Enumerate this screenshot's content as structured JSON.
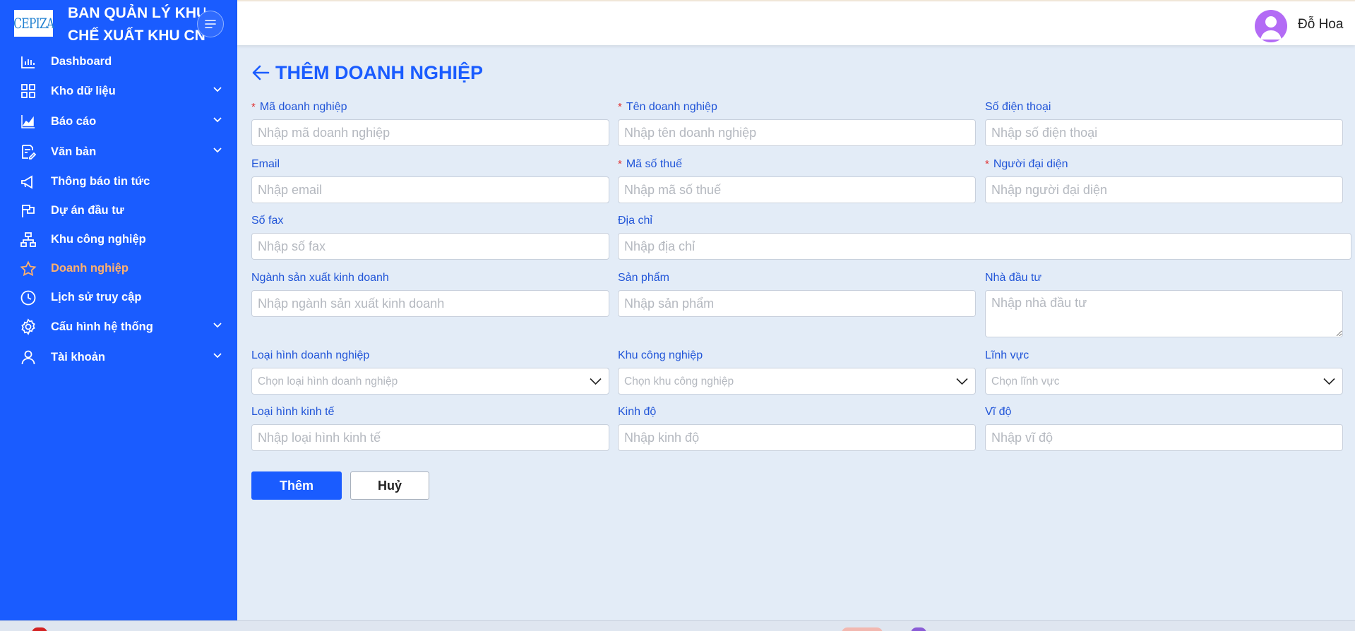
{
  "sidebar": {
    "logo_text": "CEPIZA",
    "brand_line1": "BAN QUẢN LÝ KHU",
    "brand_line2": "CHẾ XUẤT KHU CN",
    "items": [
      {
        "label": "Dashboard",
        "icon": "bar-chart-icon",
        "has_submenu": false
      },
      {
        "label": "Kho dữ liệu",
        "icon": "grid-icon",
        "has_submenu": true
      },
      {
        "label": "Báo cáo",
        "icon": "area-chart-icon",
        "has_submenu": true
      },
      {
        "label": "Văn bản",
        "icon": "document-edit-icon",
        "has_submenu": true
      },
      {
        "label": "Thông báo tin tức",
        "icon": "megaphone-icon",
        "has_submenu": false
      },
      {
        "label": "Dự án đầu tư",
        "icon": "flag-icon",
        "has_submenu": false
      },
      {
        "label": "Khu công nghiệp",
        "icon": "hierarchy-icon",
        "has_submenu": false
      },
      {
        "label": "Doanh nghiệp",
        "icon": "star-icon",
        "has_submenu": false,
        "active": true
      },
      {
        "label": "Lịch sử truy cập",
        "icon": "clock-icon",
        "has_submenu": false
      },
      {
        "label": "Cấu hình hệ thống",
        "icon": "gear-icon",
        "has_submenu": true
      },
      {
        "label": "Tài khoản",
        "icon": "user-icon",
        "has_submenu": true
      }
    ]
  },
  "header": {
    "username": "Đỗ Hoa"
  },
  "page": {
    "title": "THÊM DOANH NGHIỆP"
  },
  "form": {
    "ma_dn": {
      "label": "Mã doanh nghiệp",
      "placeholder": "Nhập mã doanh nghiệp",
      "required": true
    },
    "ten_dn": {
      "label": "Tên doanh nghiệp",
      "placeholder": "Nhập tên doanh nghiệp",
      "required": true
    },
    "sdt": {
      "label": "Số điện thoại",
      "placeholder": "Nhập số điện thoại"
    },
    "email": {
      "label": "Email",
      "placeholder": "Nhập email"
    },
    "mst": {
      "label": "Mã số thuế",
      "placeholder": "Nhập mã số thuế",
      "required": true
    },
    "nguoi_dd": {
      "label": "Người đại diện",
      "placeholder": "Nhập người đại diện",
      "required": true
    },
    "fax": {
      "label": "Số fax",
      "placeholder": "Nhập số fax"
    },
    "dia_chi": {
      "label": "Địa chỉ",
      "placeholder": "Nhập địa chỉ"
    },
    "nganh": {
      "label": "Ngành sản xuất kinh doanh",
      "placeholder": "Nhập ngành sản xuất kinh doanh"
    },
    "san_pham": {
      "label": "Sản phẩm",
      "placeholder": "Nhập sản phẩm"
    },
    "nha_dau_tu": {
      "label": "Nhà đầu tư",
      "placeholder": "Nhập nhà đầu tư"
    },
    "loai_hinh_dn": {
      "label": "Loại hình doanh nghiệp",
      "placeholder": "Chọn loại hình doanh nghiệp"
    },
    "khu_cn": {
      "label": "Khu công nghiệp",
      "placeholder": "Chọn khu công nghiệp"
    },
    "linh_vuc": {
      "label": "Lĩnh vực",
      "placeholder": "Chọn lĩnh vực"
    },
    "loai_hinh_kt": {
      "label": "Loại hình kinh tế",
      "placeholder": "Nhập loại hình kinh tế"
    },
    "kinh_do": {
      "label": "Kinh độ",
      "placeholder": "Nhập kinh độ"
    },
    "vi_do": {
      "label": "Vĩ độ",
      "placeholder": "Nhập vĩ độ"
    },
    "required_mark": "*",
    "submit_label": "Thêm",
    "cancel_label": "Huỷ"
  },
  "colors": {
    "primary": "#1a5cff",
    "active_menu": "#ffb06e",
    "label_blue": "#2155d8",
    "required": "#e03030",
    "background": "#e3ecf7",
    "avatar": "#b36bf5"
  }
}
